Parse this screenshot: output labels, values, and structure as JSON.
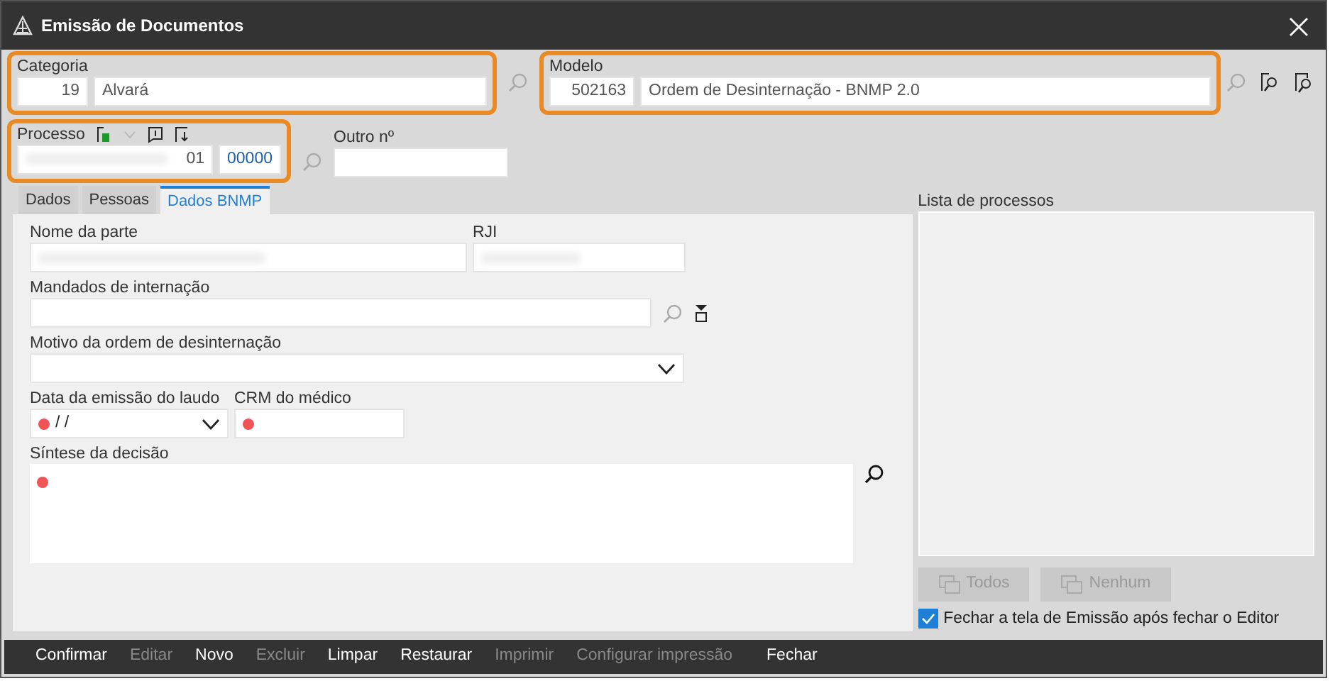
{
  "window": {
    "title": "Emissão de Documentos"
  },
  "categoria": {
    "label": "Categoria",
    "code": "19",
    "value": "Alvará",
    "highlighted": true
  },
  "modelo": {
    "label": "Modelo",
    "code": "502163",
    "value": "Ordem de Desinternação - BNMP 2.0",
    "highlighted": true
  },
  "processo": {
    "label": "Processo",
    "number_end": "01",
    "suffix": "00000",
    "highlighted": true
  },
  "outro": {
    "label": "Outro nº"
  },
  "tabs": [
    {
      "label": "Dados",
      "selected": false
    },
    {
      "label": "Pessoas",
      "selected": false
    },
    {
      "label": "Dados BNMP",
      "selected": true
    }
  ],
  "form": {
    "nome_label": "Nome da parte",
    "rji_label": "RJI",
    "mandados_label": "Mandados de internação",
    "motivo_label": "Motivo da ordem de desinternação",
    "data_label": "Data da emissão do laudo",
    "data_value": "/ /",
    "crm_label": "CRM do médico",
    "sintese_label": "Síntese da decisão"
  },
  "process_list": {
    "title": "Lista de processos",
    "buttons": [
      {
        "label": "Todos",
        "disabled": true
      },
      {
        "label": "Nenhum",
        "disabled": true
      }
    ]
  },
  "close_option": {
    "label": "Fechar a tela de Emissão após fechar o Editor",
    "checked": true
  },
  "actions": [
    {
      "label": "Confirmar",
      "disabled": false
    },
    {
      "label": "Editar",
      "disabled": true
    },
    {
      "label": "Novo",
      "disabled": false
    },
    {
      "label": "Excluir",
      "disabled": true
    },
    {
      "label": "Limpar",
      "disabled": false
    },
    {
      "label": "Restaurar",
      "disabled": false
    },
    {
      "label": "Imprimir",
      "disabled": true
    },
    {
      "label": "Configurar impressão",
      "disabled": true
    },
    {
      "label": "Fechar",
      "disabled": false
    }
  ]
}
